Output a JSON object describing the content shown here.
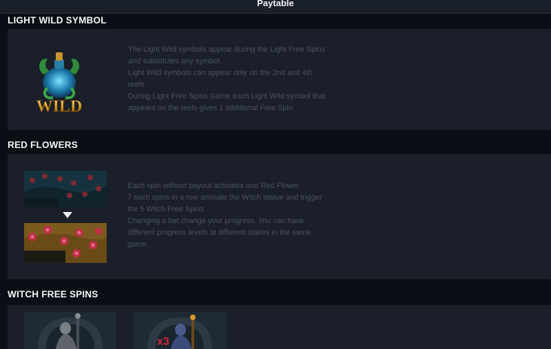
{
  "header": {
    "title": "Paytable"
  },
  "sections": {
    "light_wild": {
      "title": "LIGHT WILD SYMBOL",
      "icon_text": "WILD",
      "description": "The Light Wild symbols appear during the Light Free Spins\nand substitutes any symbol.\nLight Wild symbols can appear only on the 2nd and 4th\nreels\nDuring Light Free Spins Game each Light Wild symbol that\nappears on the reels gives 1 additional Free Spin."
    },
    "red_flowers": {
      "title": "RED FLOWERS",
      "description": "Each spin without payout activates one Red Flower.\n7 such spins in a row animate the Witch statue and trigger\nthe 5 Witch Free Spins\nChanging a bet change your progress. You can have\ndifferent progress levels at different stakes in the same\ngame."
    },
    "witch_free_spins": {
      "title": "WITCH FREE SPINS",
      "badge_text": "x3"
    }
  },
  "colors": {
    "background": "#0b0f15",
    "panel": "#1a1f29",
    "text_muted": "#4a5262",
    "wild_gold": "#d89a2a",
    "flower_red": "#c0304a"
  }
}
